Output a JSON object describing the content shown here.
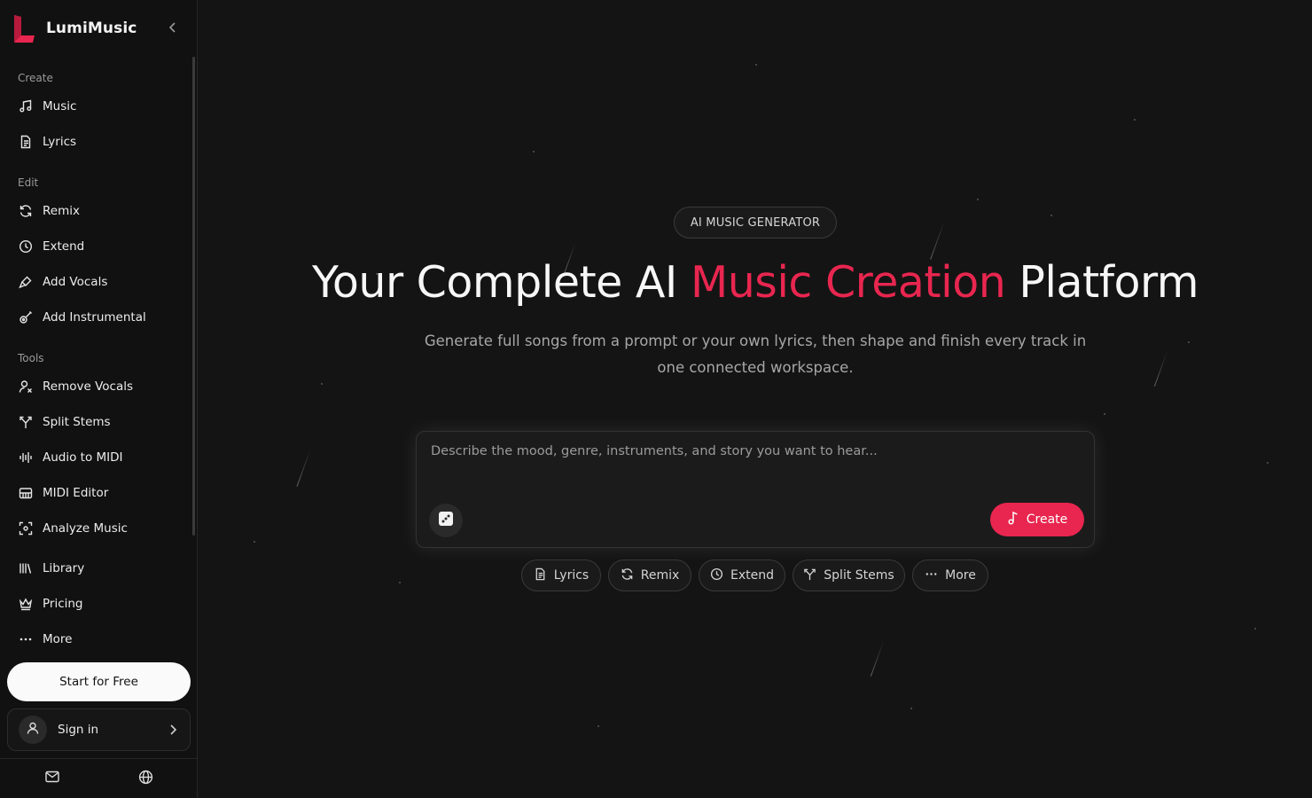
{
  "brand": {
    "name": "LumiMusic",
    "accent_color": "#e8264f"
  },
  "sidebar": {
    "sections": {
      "create": "Create",
      "edit": "Edit",
      "tools": "Tools"
    },
    "items": [
      {
        "label": "Music",
        "icon": "music-note-icon"
      },
      {
        "label": "Lyrics",
        "icon": "document-icon"
      },
      {
        "label": "Remix",
        "icon": "refresh-icon"
      },
      {
        "label": "Extend",
        "icon": "clock-icon"
      },
      {
        "label": "Add Vocals",
        "icon": "microphone-icon"
      },
      {
        "label": "Add Instrumental",
        "icon": "guitar-icon"
      },
      {
        "label": "Remove Vocals",
        "icon": "user-remove-icon"
      },
      {
        "label": "Split Stems",
        "icon": "split-icon"
      },
      {
        "label": "Audio to MIDI",
        "icon": "waveform-icon"
      },
      {
        "label": "MIDI Editor",
        "icon": "piano-icon"
      },
      {
        "label": "Analyze Music",
        "icon": "scan-icon"
      },
      {
        "label": "Library",
        "icon": "library-icon"
      },
      {
        "label": "Pricing",
        "icon": "crown-icon"
      },
      {
        "label": "More",
        "icon": "ellipsis-icon"
      }
    ],
    "start_label": "Start for Free",
    "signin_label": "Sign in"
  },
  "hero": {
    "eyebrow": "AI MUSIC GENERATOR",
    "headline_start": "Your Complete AI ",
    "headline_accent": "Music Creation",
    "headline_end": " Platform",
    "subtitle": "Generate full songs from a prompt or your own lyrics, then shape and finish every track in one connected workspace."
  },
  "prompt": {
    "placeholder": "Describe the mood, genre, instruments, and story you want to hear...",
    "create_label": "Create"
  },
  "chips": [
    {
      "label": "Lyrics",
      "icon": "document-icon"
    },
    {
      "label": "Remix",
      "icon": "refresh-icon"
    },
    {
      "label": "Extend",
      "icon": "clock-icon"
    },
    {
      "label": "Split Stems",
      "icon": "split-icon"
    },
    {
      "label": "More",
      "icon": "ellipsis-icon"
    }
  ]
}
